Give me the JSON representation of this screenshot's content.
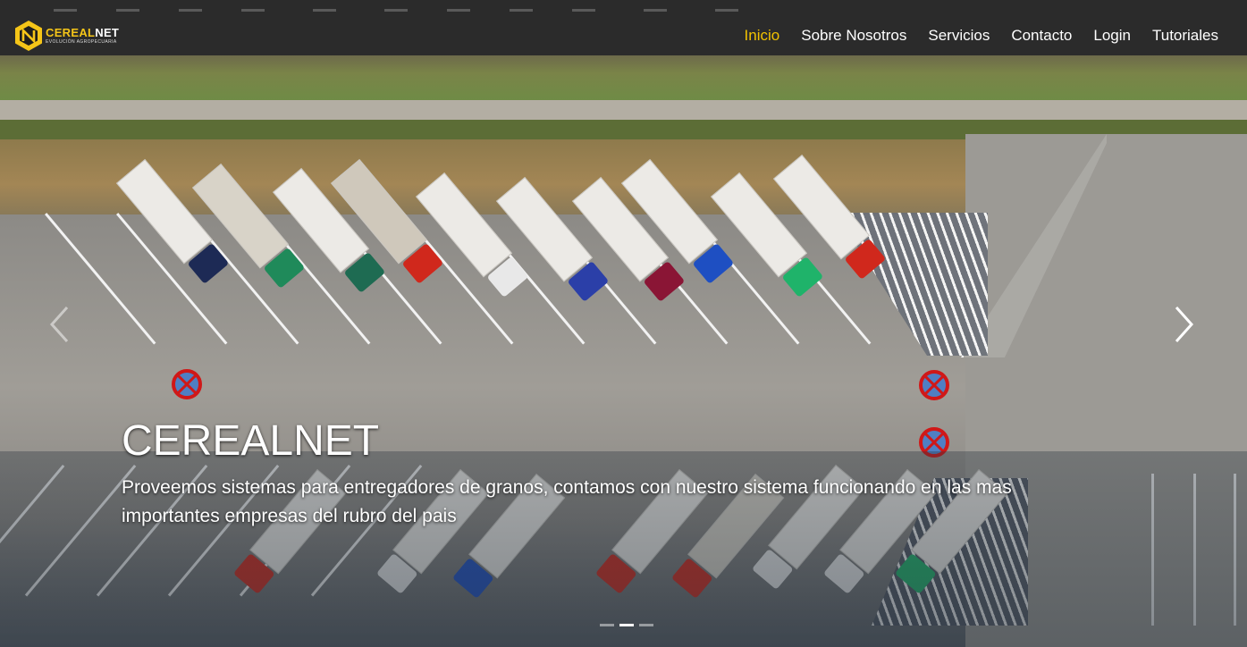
{
  "brand": {
    "name_part1": "CEREAL",
    "name_part2": "NET",
    "tagline": "EVOLUCIÓN AGROPECUARIA",
    "accent_color": "#f5c518"
  },
  "nav": {
    "items": [
      {
        "label": "Inicio",
        "active": true
      },
      {
        "label": "Sobre Nosotros",
        "active": false
      },
      {
        "label": "Servicios",
        "active": false
      },
      {
        "label": "Contacto",
        "active": false
      },
      {
        "label": "Login",
        "active": false
      },
      {
        "label": "Tutoriales",
        "active": false
      }
    ],
    "active_color": "#f2c200"
  },
  "carousel": {
    "slide_title": "CEREALNET",
    "slide_text": "Proveemos sistemas para entregadores de granos, contamos con nuestro sistema funcionando en las mas importantes empresas del rubro del pais",
    "prev_icon": "chevron-left-icon",
    "next_icon": "chevron-right-icon",
    "slide_count": 3,
    "active_slide": 2
  }
}
